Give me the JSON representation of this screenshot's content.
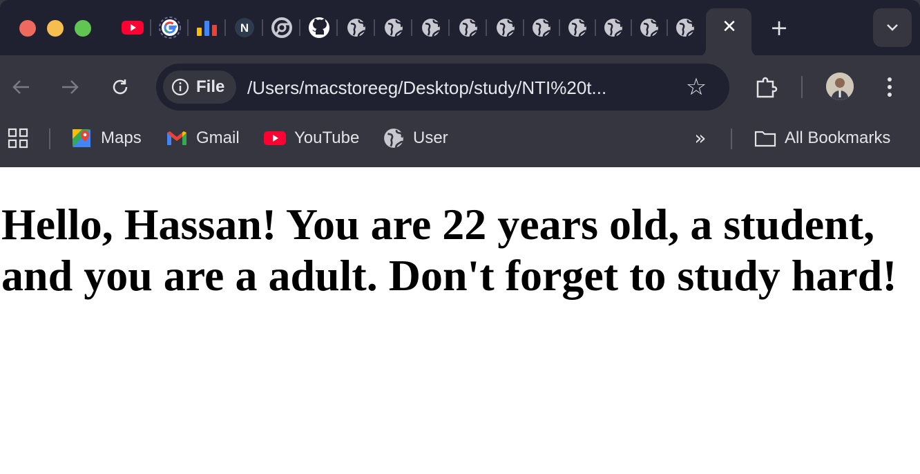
{
  "window": {
    "traffic_lights": [
      "close",
      "minimize",
      "zoom"
    ]
  },
  "tabs": {
    "icons": [
      "youtube-icon",
      "google-icon",
      "analytics-icon",
      "notion-icon",
      "chrome-icon",
      "github-icon",
      "globe-icon",
      "globe-icon",
      "globe-icon",
      "globe-icon",
      "globe-icon",
      "globe-icon",
      "globe-icon",
      "globe-icon",
      "globe-icon",
      "globe-icon"
    ],
    "active_tab_close": "✕",
    "new_tab": "+"
  },
  "toolbar": {
    "site_info_label": "File",
    "url": "/Users/macstoreeg/Desktop/study/NTI%20t...",
    "bookmark_star": "☆"
  },
  "bookmarks": {
    "items": [
      {
        "label": "Maps",
        "icon": "maps-icon"
      },
      {
        "label": "Gmail",
        "icon": "gmail-icon"
      },
      {
        "label": "YouTube",
        "icon": "youtube-icon"
      },
      {
        "label": "User",
        "icon": "globe-icon"
      }
    ],
    "overflow": "»",
    "all_bookmarks": "All Bookmarks"
  },
  "page": {
    "greeting": "Hello, Hassan! You are 22 years old, a student, and you are a adult. Don't forget to study hard!"
  },
  "colors": {
    "tabstrip_bg": "#1f2030",
    "toolbar_bg": "#35363f",
    "page_bg": "#ffffff",
    "text_light": "#e3e3e8"
  }
}
